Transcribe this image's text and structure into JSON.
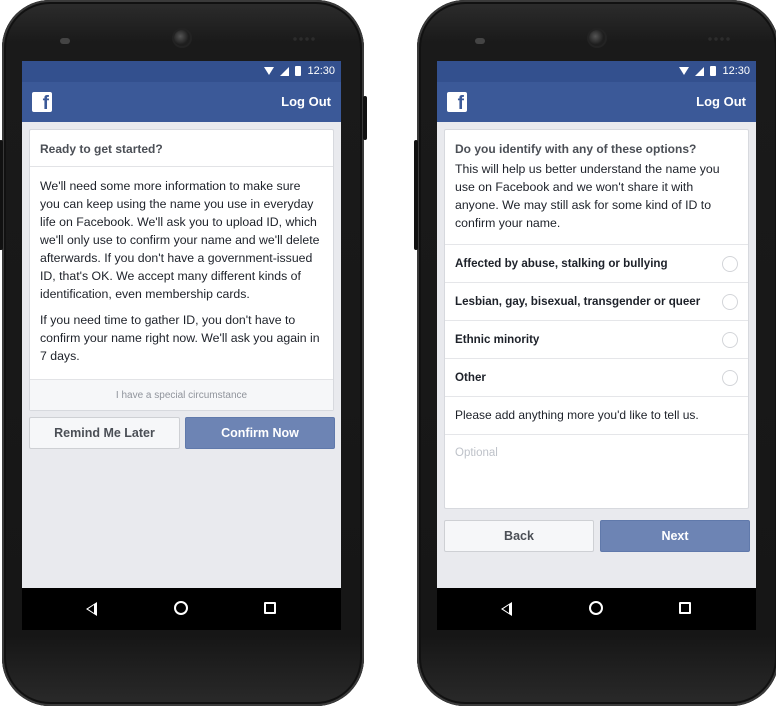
{
  "status_bar": {
    "time": "12:30"
  },
  "app_bar": {
    "logo": "f",
    "logout_label": "Log Out"
  },
  "left_screen": {
    "title": "Ready to get started?",
    "paragraph1": "We'll need some more information to make sure you can keep using the name you use in everyday life on Facebook. We'll ask you to upload ID, which we'll only use to confirm your name and we'll delete afterwards. If you don't have a government-issued ID, that's OK. We accept many different kinds of identification, even membership cards.",
    "paragraph2": "If you need time to gather ID, you don't have to confirm your name right now. We'll ask you again in 7 days.",
    "special_link": "I have a special circumstance",
    "remind_button": "Remind Me Later",
    "confirm_button": "Confirm Now"
  },
  "right_screen": {
    "question": "Do you identify with any of these options?",
    "description": "This will help us better understand the name you use on Facebook and we won't share it with anyone. We may still ask for some kind of ID to confirm your name.",
    "options": [
      "Affected by abuse, stalking or bullying",
      "Lesbian, gay, bisexual, transgender or queer",
      "Ethnic minority",
      "Other"
    ],
    "more_prompt": "Please add anything more you'd like to tell us.",
    "textarea_placeholder": "Optional",
    "back_button": "Back",
    "next_button": "Next"
  },
  "colors": {
    "facebook_blue": "#3b5998",
    "status_blue": "#33508e",
    "button_blue": "#6d84b4"
  }
}
